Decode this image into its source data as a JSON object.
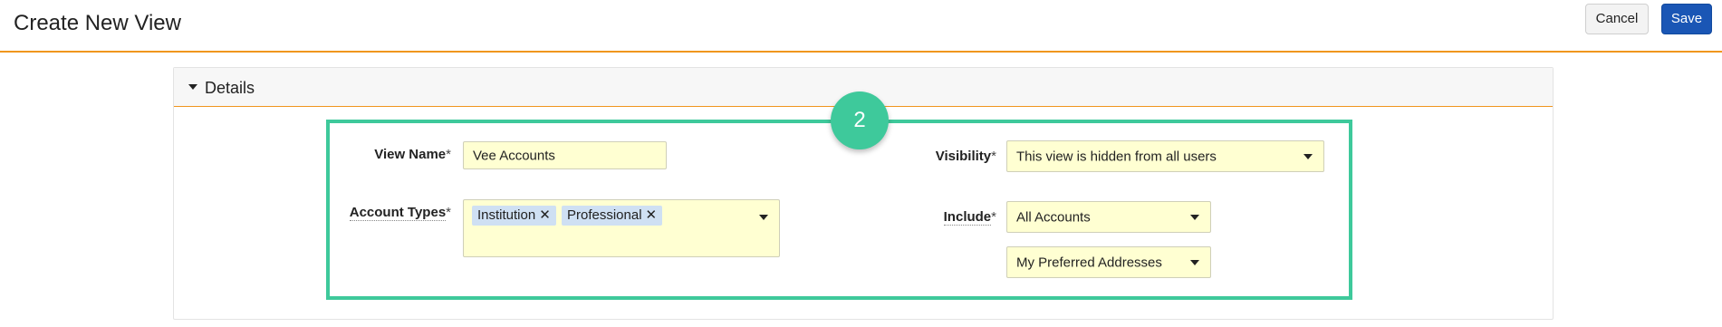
{
  "header": {
    "title": "Create New View",
    "cancel_label": "Cancel",
    "save_label": "Save"
  },
  "details": {
    "section_title": "Details",
    "step_number": "2",
    "view_name": {
      "label": "View Name",
      "required": "*",
      "value": "Vee Accounts"
    },
    "account_types": {
      "label": "Account Types",
      "required": "*",
      "tags": [
        "Institution",
        "Professional"
      ],
      "remove_glyph": "✕"
    },
    "visibility": {
      "label": "Visibility",
      "required": "*",
      "value": "This view is hidden from all users"
    },
    "include": {
      "label": "Include",
      "required": "*",
      "value": "All Accounts",
      "secondary_value": "My Preferred Addresses"
    }
  },
  "colors": {
    "accent_orange": "#f0961e",
    "highlight_green": "#3ec99b",
    "save_blue": "#1a56b5",
    "field_yellow": "#ffffd2",
    "tag_blue": "#cfe0f3"
  },
  "icons": {
    "section_toggle": "caret-down-icon",
    "dropdown": "chevron-down-icon",
    "tag_remove": "close-icon"
  }
}
